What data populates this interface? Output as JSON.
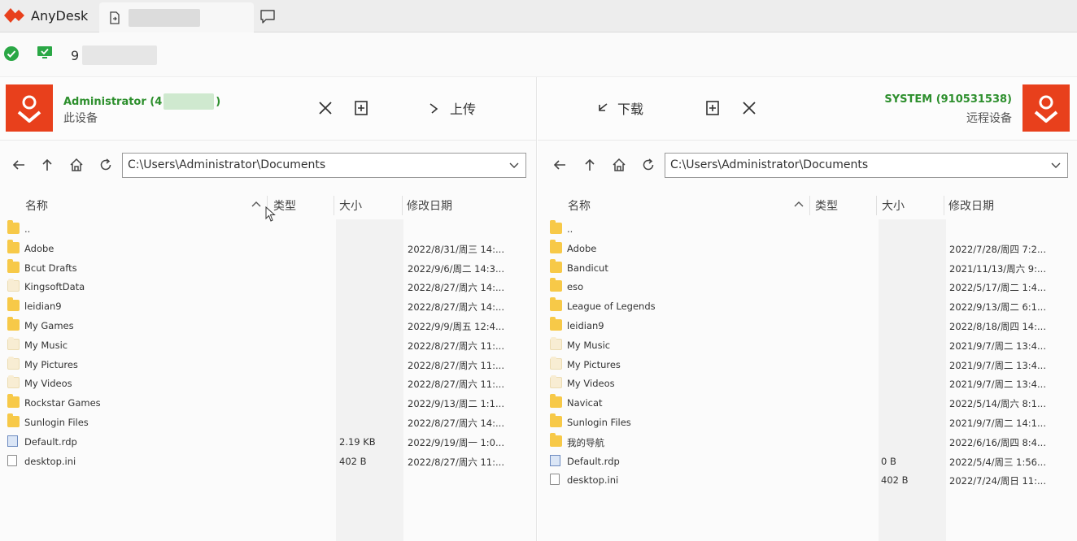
{
  "app": {
    "name": "AnyDesk"
  },
  "status": {
    "id_prefix": "9"
  },
  "local": {
    "name": "Administrator (4",
    "name_suffix": ")",
    "subtitle": "此设备",
    "upload_label": "上传",
    "path": "C:\\Users\\Administrator\\Documents",
    "columns": {
      "name": "名称",
      "type": "类型",
      "size": "大小",
      "modified": "修改日期"
    },
    "files": [
      {
        "name": "..",
        "kind": "folder",
        "size": "",
        "date": ""
      },
      {
        "name": "Adobe",
        "kind": "folder",
        "size": "",
        "date": "2022/8/31/周三 14:..."
      },
      {
        "name": "Bcut Drafts",
        "kind": "folder",
        "size": "",
        "date": "2022/9/6/周二 14:3..."
      },
      {
        "name": "KingsoftData",
        "kind": "folder-pale",
        "size": "",
        "date": "2022/8/27/周六 14:..."
      },
      {
        "name": "leidian9",
        "kind": "folder",
        "size": "",
        "date": "2022/8/27/周六 14:..."
      },
      {
        "name": "My Games",
        "kind": "folder",
        "size": "",
        "date": "2022/9/9/周五 12:4..."
      },
      {
        "name": "My Music",
        "kind": "folder-pale",
        "size": "",
        "date": "2022/8/27/周六 11:..."
      },
      {
        "name": "My Pictures",
        "kind": "folder-pale",
        "size": "",
        "date": "2022/8/27/周六 11:..."
      },
      {
        "name": "My Videos",
        "kind": "folder-pale",
        "size": "",
        "date": "2022/8/27/周六 11:..."
      },
      {
        "name": "Rockstar Games",
        "kind": "folder",
        "size": "",
        "date": "2022/9/13/周二 1:1..."
      },
      {
        "name": "Sunlogin Files",
        "kind": "folder",
        "size": "",
        "date": "2022/8/27/周六 14:..."
      },
      {
        "name": "Default.rdp",
        "kind": "rdp",
        "size": "2.19 KB",
        "date": "2022/9/19/周一 1:0..."
      },
      {
        "name": "desktop.ini",
        "kind": "file",
        "size": "402 B",
        "date": "2022/8/27/周六 11:..."
      }
    ]
  },
  "remote": {
    "name": "SYSTEM (910531538)",
    "subtitle": "远程设备",
    "download_label": "下载",
    "path": "C:\\Users\\Administrator\\Documents",
    "columns": {
      "name": "名称",
      "type": "类型",
      "size": "大小",
      "modified": "修改日期"
    },
    "files": [
      {
        "name": "..",
        "kind": "folder",
        "size": "",
        "date": ""
      },
      {
        "name": "Adobe",
        "kind": "folder",
        "size": "",
        "date": "2022/7/28/周四 7:2..."
      },
      {
        "name": "Bandicut",
        "kind": "folder",
        "size": "",
        "date": "2021/11/13/周六 9:..."
      },
      {
        "name": "eso",
        "kind": "folder",
        "size": "",
        "date": "2022/5/17/周二 1:4..."
      },
      {
        "name": "League of Legends",
        "kind": "folder",
        "size": "",
        "date": "2022/9/13/周二 6:1..."
      },
      {
        "name": "leidian9",
        "kind": "folder",
        "size": "",
        "date": "2022/8/18/周四 14:..."
      },
      {
        "name": "My Music",
        "kind": "folder-pale",
        "size": "",
        "date": "2021/9/7/周二 13:4..."
      },
      {
        "name": "My Pictures",
        "kind": "folder-pale",
        "size": "",
        "date": "2021/9/7/周二 13:4..."
      },
      {
        "name": "My Videos",
        "kind": "folder-pale",
        "size": "",
        "date": "2021/9/7/周二 13:4..."
      },
      {
        "name": "Navicat",
        "kind": "folder",
        "size": "",
        "date": "2022/5/14/周六 8:1..."
      },
      {
        "name": "Sunlogin Files",
        "kind": "folder",
        "size": "",
        "date": "2021/9/7/周二 14:1..."
      },
      {
        "name": "我的导航",
        "kind": "folder",
        "size": "",
        "date": "2022/6/16/周四 8:4..."
      },
      {
        "name": "Default.rdp",
        "kind": "rdp",
        "size": "0 B",
        "date": "2022/5/4/周三 1:56..."
      },
      {
        "name": "desktop.ini",
        "kind": "file",
        "size": "402 B",
        "date": "2022/7/24/周日 11:..."
      }
    ]
  },
  "colors": {
    "accent": "#e8401c",
    "online": "#2d8f2d",
    "folder": "#f7c948"
  }
}
